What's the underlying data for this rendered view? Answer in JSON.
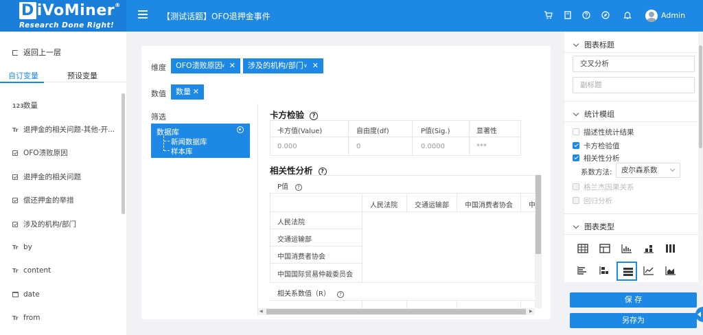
{
  "header": {
    "logo": "DiVoMiner",
    "tagline": "Research Done Right!",
    "title": "【测试话题】OFO退押金事件",
    "user": "Admin"
  },
  "sidebar": {
    "back": "返回上一层",
    "tabs": [
      "自订变量",
      "预设变量"
    ],
    "type_icons": {
      "number": "123",
      "text": "Tr"
    },
    "items": [
      {
        "label": "数量",
        "icon": "number"
      },
      {
        "label": "退押金的相关问题-其他-开...",
        "icon": "text"
      },
      {
        "label": "OFO溃败原因",
        "icon": "checkbox"
      },
      {
        "label": "退押金的相关问题",
        "icon": "checkbox"
      },
      {
        "label": "偿还押金的举措",
        "icon": "checkbox"
      },
      {
        "label": "涉及的机构/部门",
        "icon": "checkbox"
      },
      {
        "label": "by",
        "icon": "text"
      },
      {
        "label": "content",
        "icon": "text"
      },
      {
        "label": "date",
        "icon": "calendar"
      },
      {
        "label": "from",
        "icon": "text"
      }
    ]
  },
  "main": {
    "dimension_label": "维度",
    "dimension_tags": [
      "OFO溃败原因",
      "涉及的机构/部门"
    ],
    "value_label": "数值",
    "value_tag": "数量",
    "filter_label": "筛选",
    "database": {
      "title": "数据库",
      "children": [
        "新闻数据库",
        "样本库"
      ]
    },
    "chi": {
      "title": "卡方检验",
      "headers": [
        "卡方值(Value)",
        "自由度(df)",
        "P值(Sig.)",
        "显著性"
      ],
      "row": [
        "0.000",
        "0",
        "0.0000",
        "***"
      ]
    },
    "corr": {
      "title": "相关性分析",
      "p_label": "P值",
      "columns": [
        "人民法院",
        "交通运输部",
        "中国消费者协会",
        "中"
      ],
      "rows": [
        "人民法院",
        "交通运输部",
        "中国消费者协会",
        "中国国际贸易仲裁委员会"
      ],
      "coef_label": "相关系数值（R）"
    },
    "help_symbol": "?",
    "close_symbol": "✕",
    "dropdown_symbol": "∨"
  },
  "right_panel": {
    "chart_title_head": "图表标题",
    "title_value": "交叉分析",
    "subtitle_placeholder": "副标题",
    "stats_head": "统计模组",
    "stats": [
      {
        "label": "描述性统计结果",
        "state": "off"
      },
      {
        "label": "卡方检验值",
        "state": "on"
      },
      {
        "label": "相关性分析",
        "state": "on"
      },
      {
        "label": "格兰杰因果关系",
        "state": "disabled"
      },
      {
        "label": "回归分析",
        "state": "disabled"
      }
    ],
    "method_label": "系数方法:",
    "method_value": "皮尔森系数",
    "chart_type_head": "图表类型",
    "chart_types": [
      "table-icon",
      "pivot-table-icon",
      "bar-chart-icon",
      "stacked-bar-icon",
      "column-group-icon",
      "horizontal-bar-icon",
      "horizontal-stacked-icon",
      "horizontal-list-icon",
      "line-chart-icon",
      "area-chart-icon"
    ],
    "selected_chart_type": "horizontal-list-icon",
    "save": "保 存",
    "save_as": "另存为"
  },
  "colors": {
    "accent": "#1e88e5",
    "header": "#1e88e5"
  }
}
